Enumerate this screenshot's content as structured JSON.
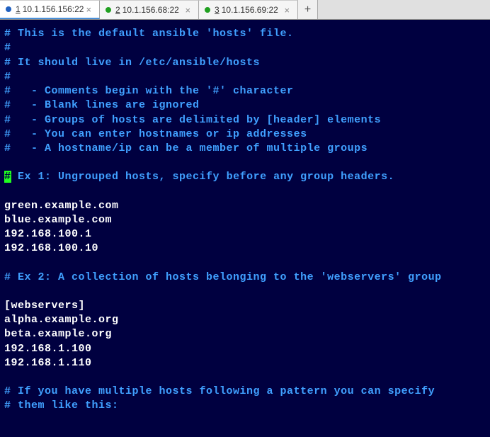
{
  "tabs": [
    {
      "number": "1",
      "label": "10.1.156.156:22",
      "active": true,
      "dot": "blue"
    },
    {
      "number": "2",
      "label": "10.1.156.68:22",
      "active": false,
      "dot": "green"
    },
    {
      "number": "3",
      "label": "10.1.156.69:22",
      "active": false,
      "dot": "green"
    }
  ],
  "lines": [
    {
      "text": "# This is the default ansible 'hosts' file.",
      "cls": "comment"
    },
    {
      "text": "#",
      "cls": "comment"
    },
    {
      "text": "# It should live in /etc/ansible/hosts",
      "cls": "comment"
    },
    {
      "text": "#",
      "cls": "comment"
    },
    {
      "text": "#   - Comments begin with the '#' character",
      "cls": "comment"
    },
    {
      "text": "#   - Blank lines are ignored",
      "cls": "comment"
    },
    {
      "text": "#   - Groups of hosts are delimited by [header] elements",
      "cls": "comment"
    },
    {
      "text": "#   - You can enter hostnames or ip addresses",
      "cls": "comment"
    },
    {
      "text": "#   - A hostname/ip can be a member of multiple groups",
      "cls": "comment"
    },
    {
      "text": "",
      "cls": "comment"
    },
    {
      "cursor": "#",
      "text": " Ex 1: Ungrouped hosts, specify before any group headers.",
      "cls": "comment"
    },
    {
      "text": "",
      "cls": "comment"
    },
    {
      "text": "green.example.com",
      "cls": "text-white"
    },
    {
      "text": "blue.example.com",
      "cls": "text-white"
    },
    {
      "text": "192.168.100.1",
      "cls": "text-white"
    },
    {
      "text": "192.168.100.10",
      "cls": "text-white"
    },
    {
      "text": "",
      "cls": "comment"
    },
    {
      "text": "# Ex 2: A collection of hosts belonging to the 'webservers' group",
      "cls": "comment"
    },
    {
      "text": "",
      "cls": "comment"
    },
    {
      "text": "[webservers]",
      "cls": "text-white"
    },
    {
      "text": "alpha.example.org",
      "cls": "text-white"
    },
    {
      "text": "beta.example.org",
      "cls": "text-white"
    },
    {
      "text": "192.168.1.100",
      "cls": "text-white"
    },
    {
      "text": "192.168.1.110",
      "cls": "text-white"
    },
    {
      "text": "",
      "cls": "comment"
    },
    {
      "text": "# If you have multiple hosts following a pattern you can specify",
      "cls": "comment"
    },
    {
      "text": "# them like this:",
      "cls": "comment"
    }
  ],
  "add_label": "+"
}
